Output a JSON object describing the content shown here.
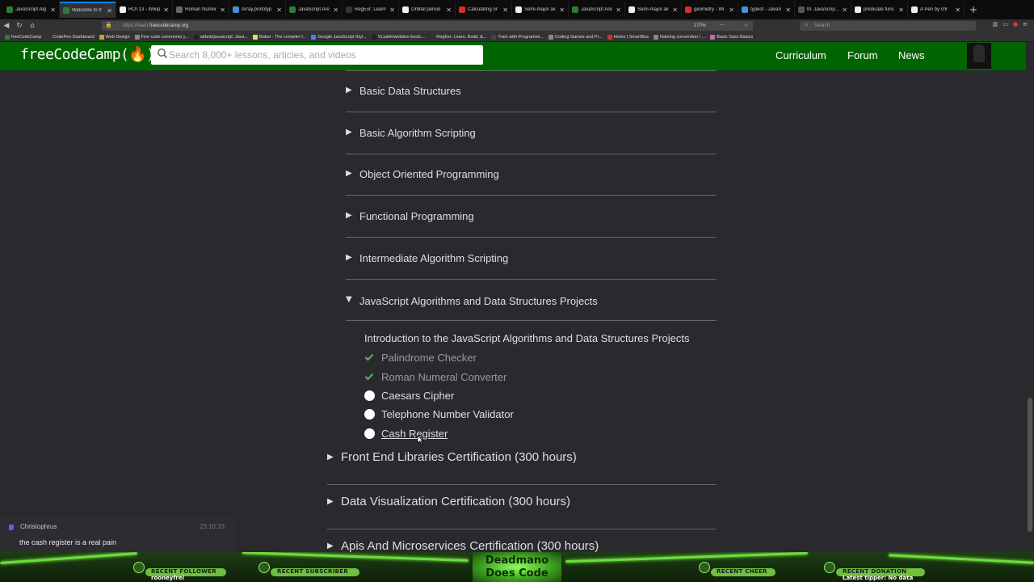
{
  "browser": {
    "tabs": [
      {
        "label": "JavaScript Alg",
        "color": "#2e7d32",
        "active": false
      },
      {
        "label": "Welcome to fr",
        "color": "#2e7d32",
        "active": true
      },
      {
        "label": "ROT13 - Wikip",
        "color": "#eeeeee",
        "active": false
      },
      {
        "label": "Roman Numer",
        "color": "#666666",
        "active": false
      },
      {
        "label": "Array.prototyp",
        "color": "#4a90d9",
        "active": false
      },
      {
        "label": "JavaScript Are",
        "color": "#2e7d32",
        "active": false
      },
      {
        "label": "RegExr: Learn",
        "color": "#333333",
        "active": false
      },
      {
        "label": "Orbital period",
        "color": "#eeeeee",
        "active": false
      },
      {
        "label": "Calculating or",
        "color": "#d32f2f",
        "active": false
      },
      {
        "label": "Semi-major ax",
        "color": "#eeeeee",
        "active": false
      },
      {
        "label": "JavaScript Are",
        "color": "#2e7d32",
        "active": false
      },
      {
        "label": "Semi-major ax",
        "color": "#eeeeee",
        "active": false
      },
      {
        "label": "geometry - Wi",
        "color": "#d32f2f",
        "active": false
      },
      {
        "label": "typeof - JavaS",
        "color": "#4a90d9",
        "active": false
      },
      {
        "label": "M. JavaScript ES",
        "color": "#555555",
        "active": false
      },
      {
        "label": "predicate func",
        "color": "#eeeeee",
        "active": false
      },
      {
        "label": "A Pen by chr",
        "color": "#eeeeee",
        "active": false
      }
    ],
    "url_prefix": "https://learn.",
    "url_domain": "freecodecamp.org",
    "zoom": "170%",
    "search_placeholder": "Search",
    "bookmarks": [
      {
        "label": "freeCodeCamp",
        "color": "#2e7d32"
      },
      {
        "label": "CodePen Dashboard",
        "color": "#333333"
      },
      {
        "label": "Web Design",
        "color": "#c9a227"
      },
      {
        "label": "Five code comments y...",
        "color": "#888888"
      },
      {
        "label": "airbnb/javascript: Java...",
        "color": "#222222"
      },
      {
        "label": "Babel · The compiler f...",
        "color": "#f5da55"
      },
      {
        "label": "Google JavaScript Styl...",
        "color": "#4285f4"
      },
      {
        "label": "VLsahk/webdev-bootc...",
        "color": "#222222"
      },
      {
        "label": "RegExr: Learn, Build, &...",
        "color": "#333333"
      },
      {
        "label": "Train with Programmi...",
        "color": "#444444"
      },
      {
        "label": "Coding Games and Pr...",
        "color": "#888888"
      },
      {
        "label": "Home | SmartBus",
        "color": "#d32f2f"
      },
      {
        "label": "Naming convention / ...",
        "color": "#888888"
      },
      {
        "label": "Basic Sass Basics",
        "color": "#cd6799"
      }
    ]
  },
  "fcc": {
    "logo": "freeCodeCamp(🔥)",
    "search_placeholder": "Search 8,000+ lessons, articles, and videos",
    "links": [
      "Curriculum",
      "Forum",
      "News"
    ],
    "brand_color": "#006400"
  },
  "curriculum": {
    "blocks": [
      "Basic Data Structures",
      "Basic Algorithm Scripting",
      "Object Oriented Programming",
      "Functional Programming",
      "Intermediate Algorithm Scripting"
    ],
    "open_block": "JavaScript Algorithms and Data Structures Projects",
    "intro": "Introduction to the JavaScript Algorithms and Data Structures Projects",
    "challenges": [
      {
        "label": "Palindrome Checker",
        "completed": true
      },
      {
        "label": "Roman Numeral Converter",
        "completed": true
      },
      {
        "label": "Caesars Cipher",
        "completed": false
      },
      {
        "label": "Telephone Number Validator",
        "completed": false
      },
      {
        "label": "Cash Register",
        "completed": false
      }
    ],
    "certifications": [
      "Front End Libraries Certification (300 hours)",
      "Data Visualization Certification (300 hours)",
      "Apis And Microservices Certification (300 hours)"
    ],
    "check_color": "#5cb85c"
  },
  "chat": {
    "user": "Christophrus",
    "time": "23:10:33",
    "message": "the cash register is a real pain"
  },
  "overlay": {
    "title_line1": "Deadmano",
    "title_line2": "Does Code",
    "labels": [
      "RECENT FOLLOWER",
      "RECENT SUBSCRIBER",
      "RECENT CHEER",
      "RECENT DONATION"
    ],
    "follower": "rooneyfrei",
    "donation": "Latest tipper: No data",
    "accent": "#7cff3f"
  }
}
